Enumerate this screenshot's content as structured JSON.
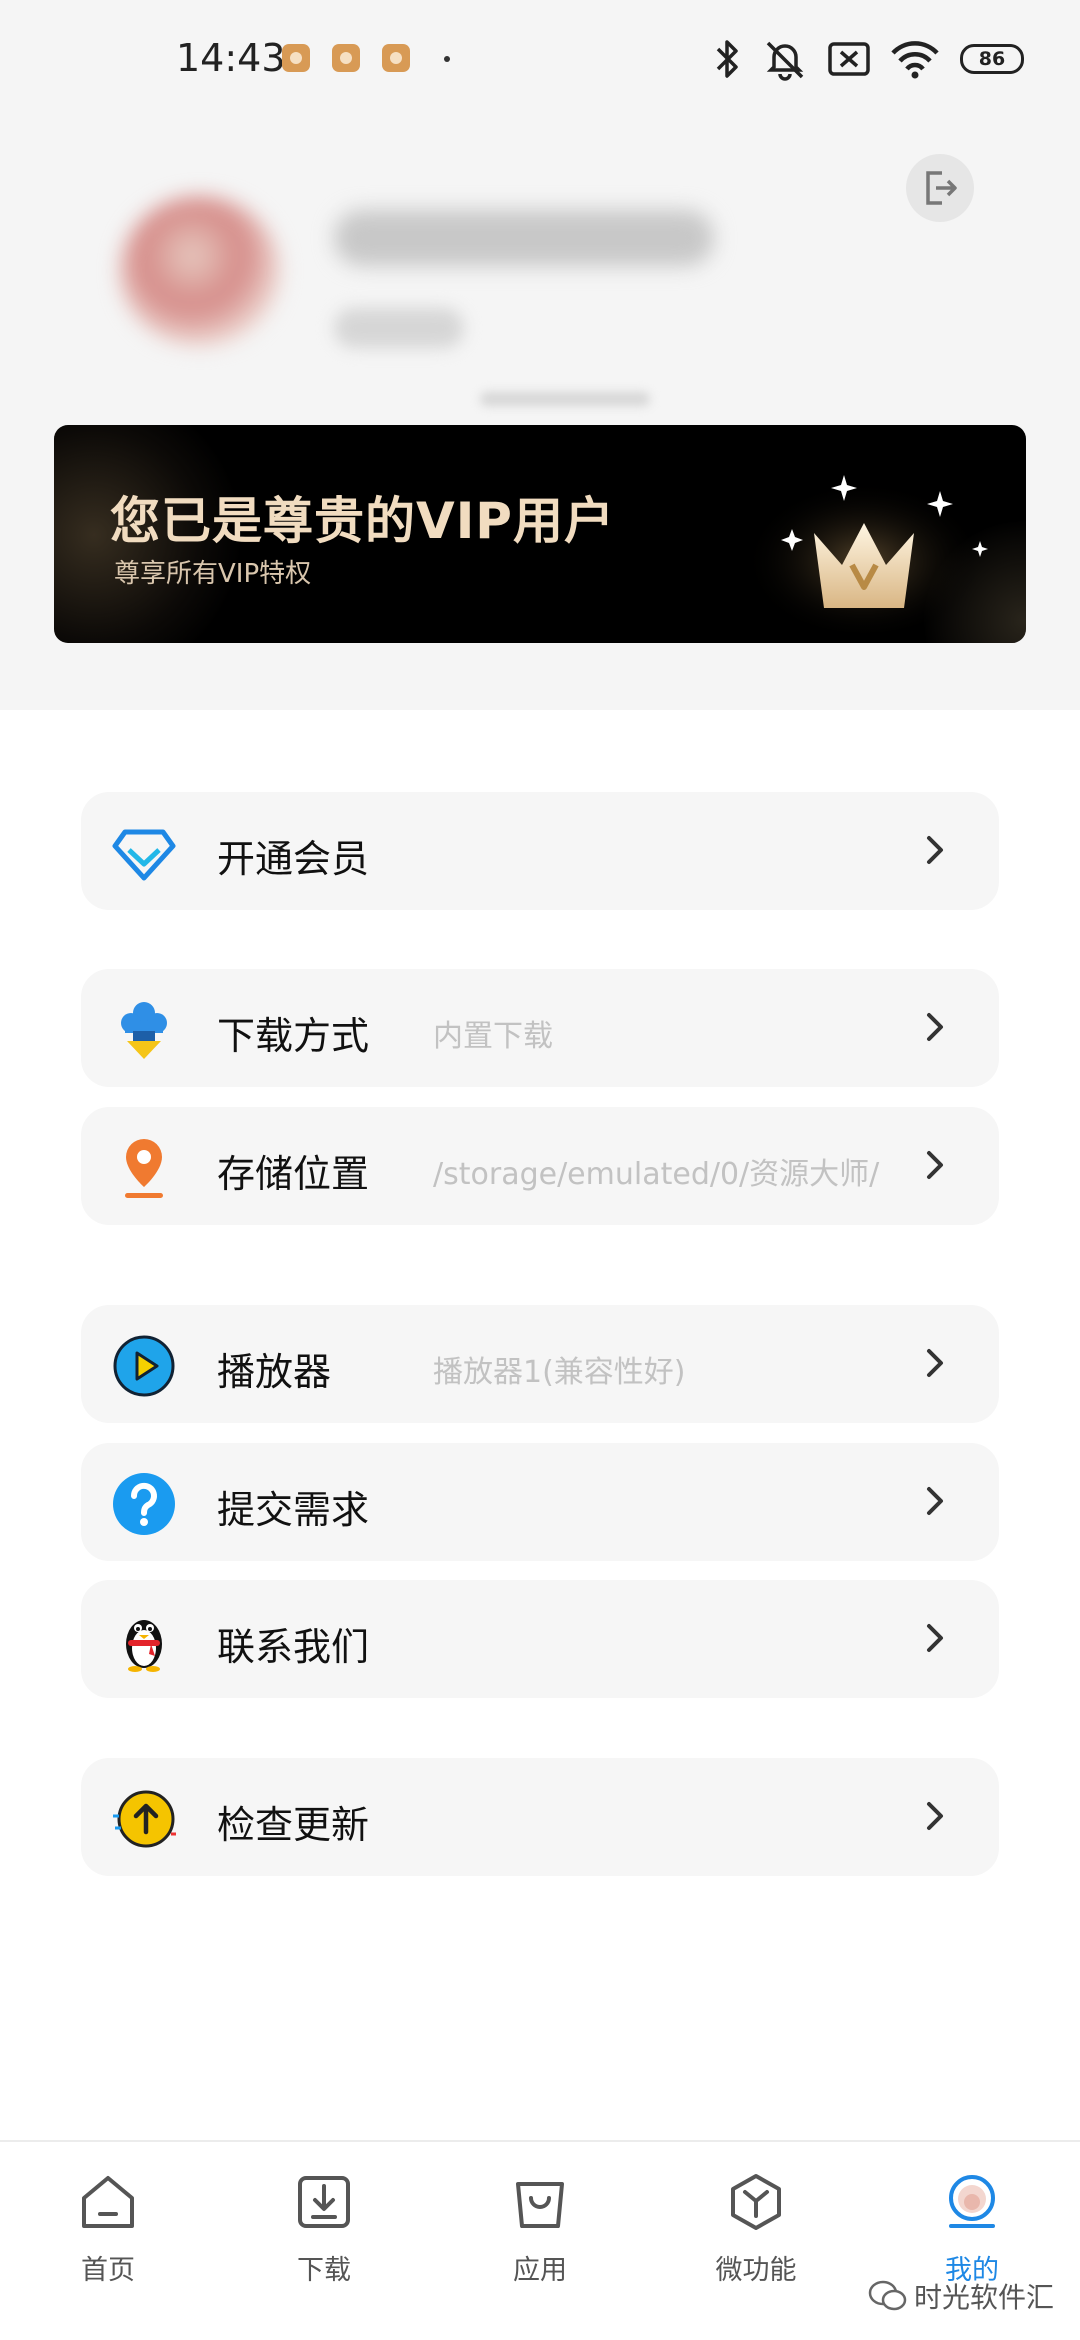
{
  "status_bar": {
    "time": "14:43",
    "battery": "86"
  },
  "vip_banner": {
    "title": "您已是尊贵的VIP用户",
    "subtitle": "尊享所有VIP特权"
  },
  "menu": {
    "membership": {
      "label": "开通会员",
      "icon": "diamond-icon"
    },
    "download_method": {
      "label": "下载方式",
      "value": "内置下载",
      "icon": "cloud-download-icon"
    },
    "storage_location": {
      "label": "存储位置",
      "value": "/storage/emulated/0/资源大师/",
      "icon": "location-pin-icon"
    },
    "player": {
      "label": "播放器",
      "value": "播放器1(兼容性好)",
      "icon": "play-icon"
    },
    "submit_request": {
      "label": "提交需求",
      "icon": "question-icon"
    },
    "contact_us": {
      "label": "联系我们",
      "icon": "penguin-icon"
    },
    "check_update": {
      "label": "检查更新",
      "icon": "upload-arrow-icon"
    }
  },
  "bottom_nav": {
    "active": "我的",
    "accent_color": "#1e88e5",
    "items": [
      {
        "label": "首页",
        "icon": "home-icon"
      },
      {
        "label": "下载",
        "icon": "download-icon"
      },
      {
        "label": "应用",
        "icon": "bag-icon"
      },
      {
        "label": "微功能",
        "icon": "cube-icon"
      },
      {
        "label": "我的",
        "icon": "profile-icon"
      }
    ]
  },
  "watermark": "时光软件汇"
}
